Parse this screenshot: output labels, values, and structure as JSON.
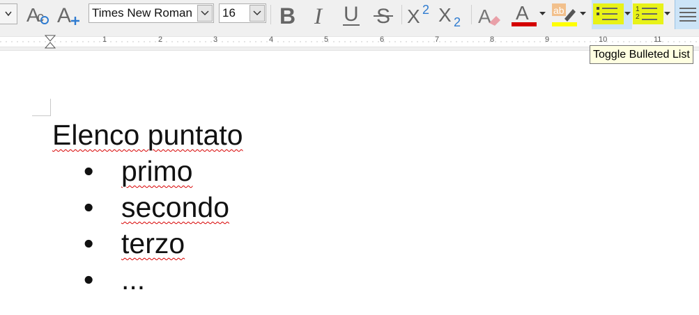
{
  "toolbar": {
    "font_name": "Times New Roman",
    "font_size": "16",
    "icons": [
      "dropdown-icon",
      "spelling-icon",
      "font-grow-icon",
      "bold-icon",
      "italic-icon",
      "underline-icon",
      "strikethrough-icon",
      "superscript-icon",
      "subscript-icon",
      "clear-formatting-icon",
      "font-color-icon",
      "highlight-icon",
      "bulleted-list-icon",
      "numbered-list-icon",
      "align-left-icon"
    ],
    "superscript_label": "X",
    "superscript_digit": "2",
    "subscript_label": "X",
    "subscript_digit": "2",
    "highlight_sample": "ab",
    "numbered_digits": "12",
    "colors": {
      "font_color": "#d40000",
      "highlight": "#ffff00",
      "active_highlight": "#e8f218",
      "selected_bg": "#cce4f7"
    }
  },
  "ruler": {
    "numbers": [
      "1",
      "2",
      "3",
      "4",
      "5",
      "6",
      "7",
      "8",
      "9",
      "10",
      "11"
    ]
  },
  "tooltip": {
    "text": "Toggle Bulleted List"
  },
  "document": {
    "heading": "Elenco puntato",
    "bullet_char": "•",
    "items": [
      "primo",
      "secondo",
      "terzo",
      "..."
    ]
  }
}
